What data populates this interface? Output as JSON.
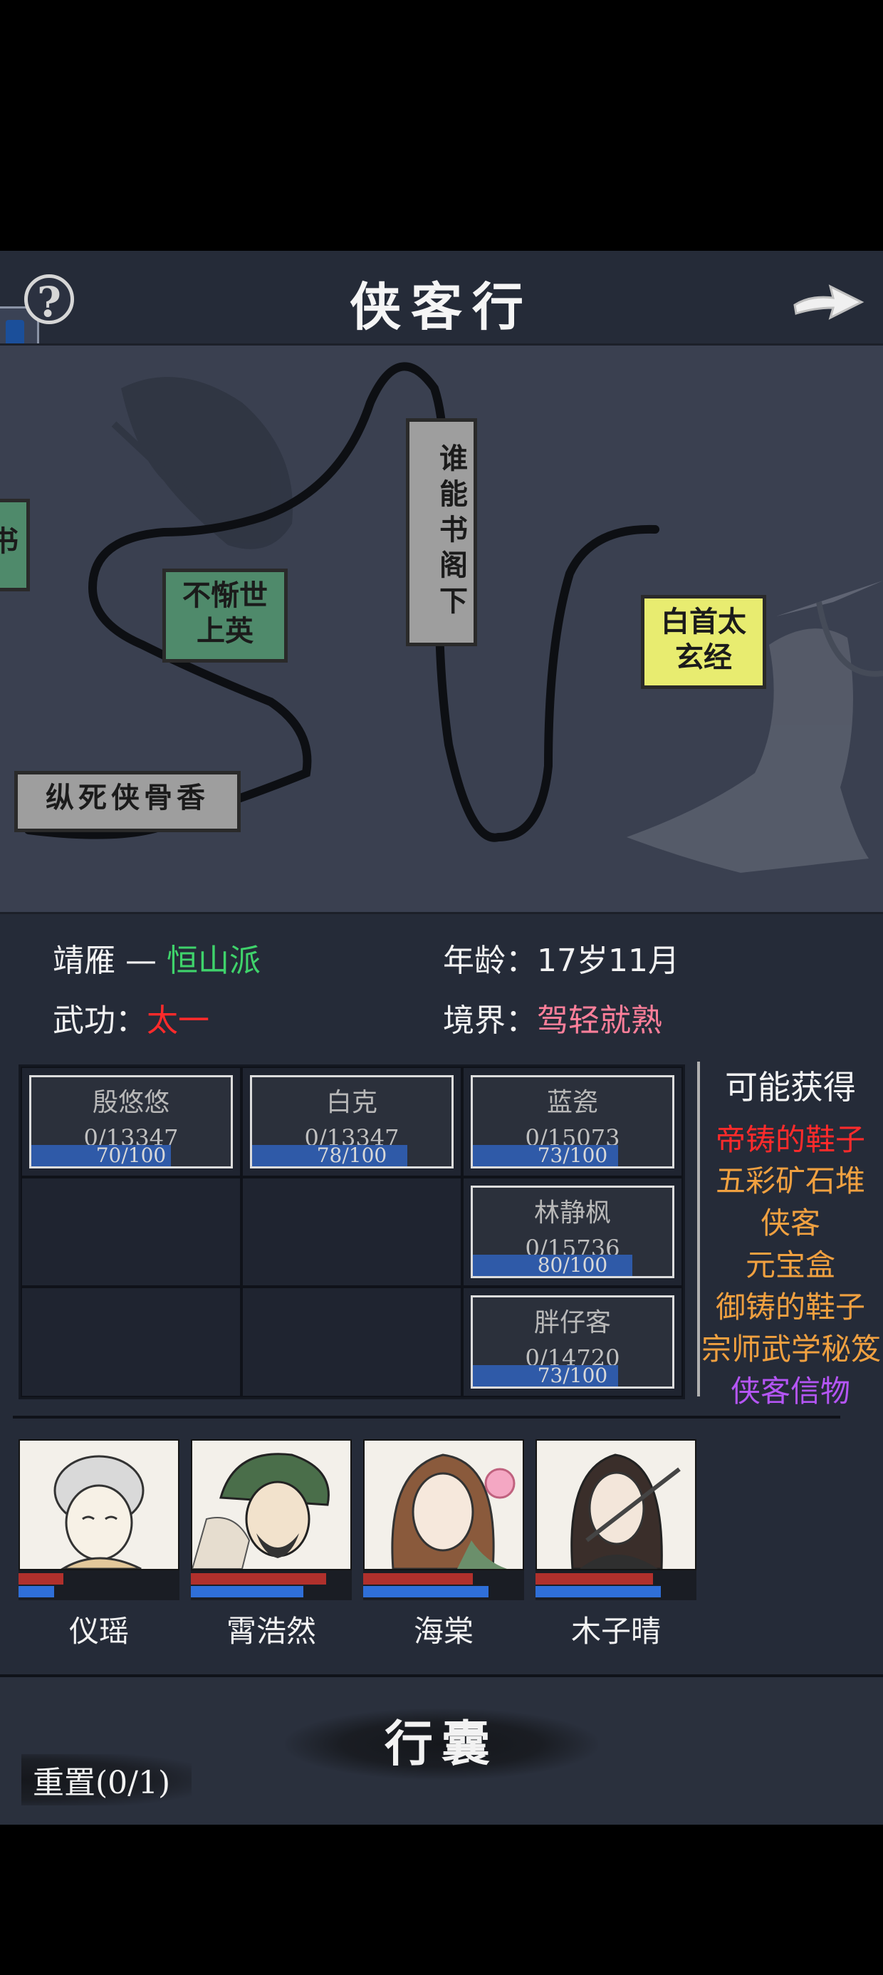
{
  "header": {
    "title": "侠客行",
    "help_icon": "?"
  },
  "map_nodes": [
    {
      "id": "partial",
      "label": "书"
    },
    {
      "id": "buxi",
      "label": "不惭世上英"
    },
    {
      "id": "shui",
      "label": "谁能书阁下"
    },
    {
      "id": "baishou",
      "label": "白首太玄经"
    },
    {
      "id": "zongsi",
      "label": "纵死侠骨香"
    }
  ],
  "info": {
    "name": "靖雁",
    "dash": "—",
    "sect": "恒山派",
    "age_label": "年龄：",
    "age_value": "17岁11月",
    "martial_label": "武功：",
    "martial_value": "太一",
    "realm_label": "境界：",
    "realm_value": "驾轻就熟"
  },
  "opponents": [
    {
      "name": "殷悠悠",
      "hp": "0/13347",
      "bar_text": "70/100",
      "bar": 70
    },
    {
      "name": "白克",
      "hp": "0/13347",
      "bar_text": "78/100",
      "bar": 78
    },
    {
      "name": "蓝瓷",
      "hp": "0/15073",
      "bar_text": "73/100",
      "bar": 73
    },
    {
      "name": "林静枫",
      "hp": "0/15736",
      "bar_text": "80/100",
      "bar": 80
    },
    {
      "name": "胖仔客",
      "hp": "0/14720",
      "bar_text": "73/100",
      "bar": 73
    }
  ],
  "rewards": {
    "title": "可能获得",
    "items": [
      {
        "label": "帝铸的鞋子",
        "color": "#ff2b2b"
      },
      {
        "label": "五彩矿石堆",
        "color": "#f0a040"
      },
      {
        "label": "侠客",
        "color": "#f0a040"
      },
      {
        "label": "元宝盒",
        "color": "#f0a040"
      },
      {
        "label": "御铸的鞋子",
        "color": "#f0a040"
      },
      {
        "label": "宗师武学秘笈",
        "color": "#f0a040"
      },
      {
        "label": "侠客信物",
        "color": "#b455f5"
      }
    ]
  },
  "heroes": [
    {
      "name": "仪瑶",
      "hp": 0.28,
      "mp": 0.22
    },
    {
      "name": "霄浩然",
      "hp": 0.84,
      "mp": 0.7
    },
    {
      "name": "海棠",
      "hp": 0.68,
      "mp": 0.78
    },
    {
      "name": "木子晴",
      "hp": 0.73,
      "mp": 0.78
    }
  ],
  "bottom": {
    "bag_label": "行囊",
    "reset_label": "重置(0/1)"
  },
  "colors": {
    "panel": "#252b38",
    "map": "#3a4050",
    "sect": "#3fd36b",
    "martial": "#ff2b2b",
    "realm": "#ff7f9a"
  }
}
